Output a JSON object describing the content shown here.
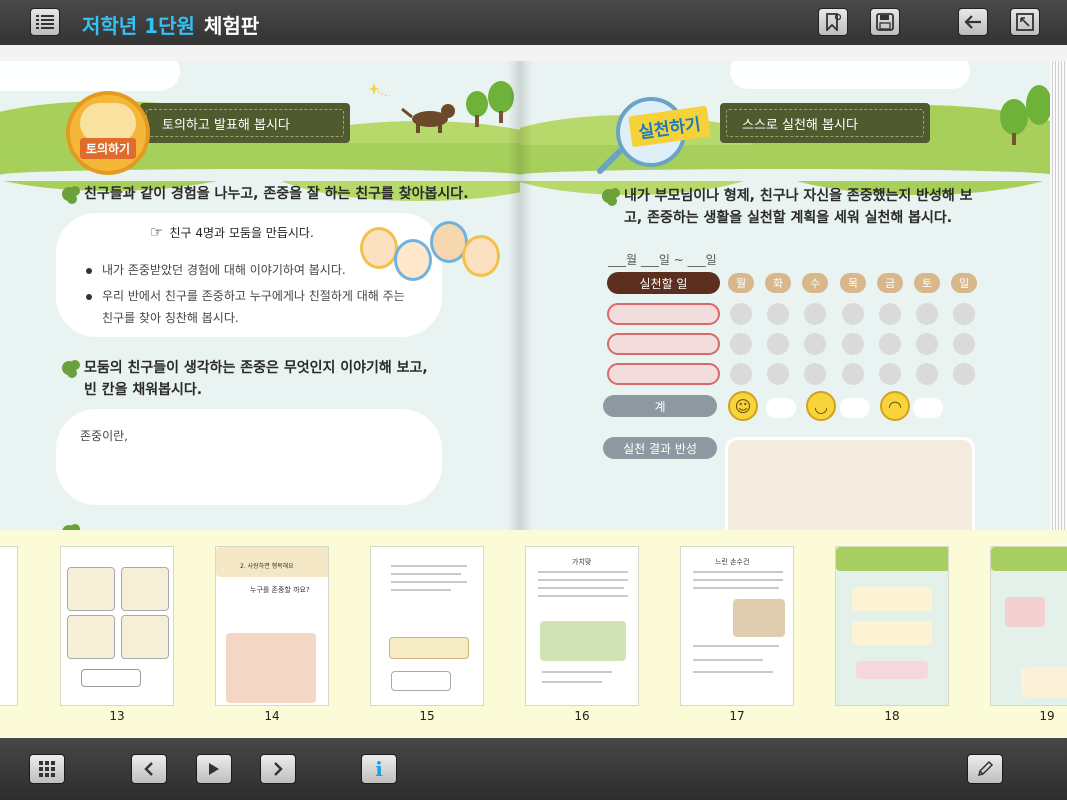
{
  "header": {
    "title_main": "저학년 1단원",
    "title_sub": "체험판"
  },
  "left_page": {
    "badge_label": "토의하기",
    "banner": "토의하고 발표해 봅시다",
    "question1": "친구들과 같이 경험을 나누고, 존중을 잘 하는 친구를 찾아봅시다.",
    "instruction": "친구 4명과 모둠을 만듭시다.",
    "bullets": [
      "내가 존중받았던 경험에 대해 이야기하여 봅시다.",
      "우리 반에서 친구를 존중하고 누구에게나 친절하게 대해 주는",
      "친구를 찾아 칭찬해 봅시다."
    ],
    "question2_line1": "모둠의 친구들이 생각하는 존중은 무엇인지 이야기해 보고,",
    "question2_line2": "빈 칸을 채워봅시다.",
    "fill_label": "존중이란,"
  },
  "right_page": {
    "badge_label": "실천하기",
    "banner": "스스로 실천해 봅시다",
    "question_line1": "내가 부모님이나 형제, 친구나 자신을 존중했는지 반성해 보",
    "question_line2": "고, 존중하는 생활을 실천할 계획을 세워 실천해 봅시다.",
    "date_line": "___월 ___일 ~ ___일",
    "task_header": "실천할 일",
    "days": [
      "월",
      "화",
      "수",
      "목",
      "금",
      "토",
      "일"
    ],
    "total_label": "계",
    "result_label": "실천 결과 반성"
  },
  "thumbnails": [
    {
      "page": "13"
    },
    {
      "page": "14"
    },
    {
      "page": "15"
    },
    {
      "page": "16"
    },
    {
      "page": "17"
    },
    {
      "page": "18"
    },
    {
      "page": "19"
    }
  ],
  "thumb_text": {
    "t14_heading": "2. 사랑하면 행복해요",
    "t14_sub": "누구를 존중할 까요?",
    "t16_heading": "가치맞",
    "t17_heading": "느린 손수건"
  },
  "icons": {
    "menu": "list-menu-icon",
    "bookmark": "bookmark-icon",
    "save": "save-icon",
    "back": "back-arrow-icon",
    "fit": "fit-screen-icon",
    "grid": "grid-icon",
    "prev": "chevron-left-icon",
    "play": "play-icon",
    "next": "chevron-right-icon",
    "info": "info-icon",
    "pen": "pencil-icon"
  },
  "colors": {
    "title_accent": "#35c2f2",
    "banner": "#4f5a2e",
    "thumb_strip": "#fcfbd8"
  }
}
